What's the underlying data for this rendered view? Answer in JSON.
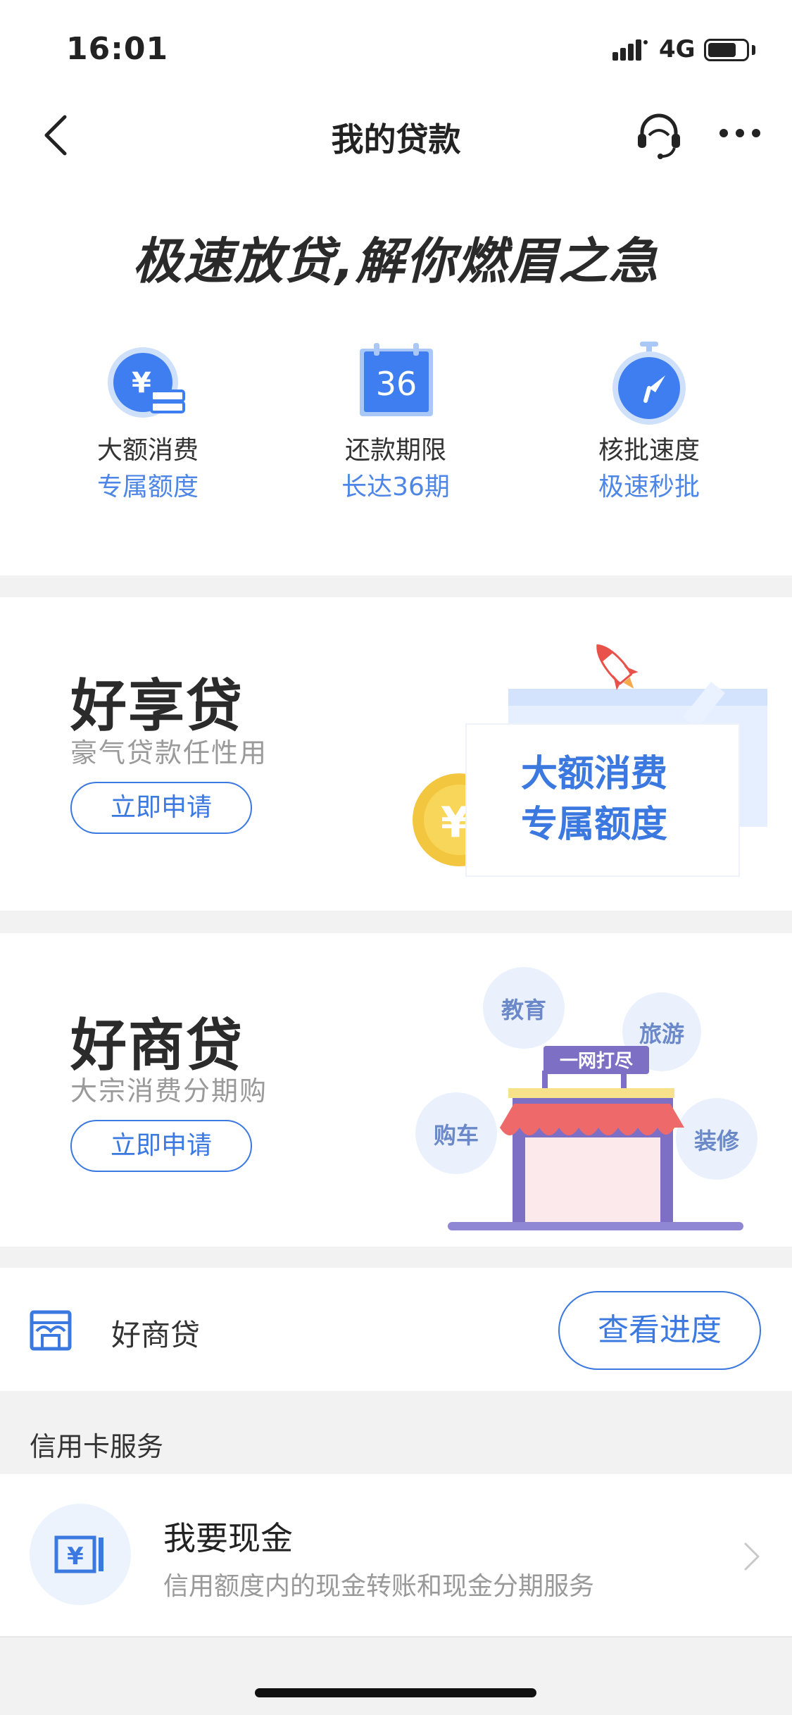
{
  "status_bar": {
    "time": "16:01",
    "network": "4G",
    "battery_level": 0.75
  },
  "nav": {
    "title": "我的贷款",
    "back_icon": "chevron-left-icon",
    "support_icon": "headset-icon",
    "more_icon": "more-dots-icon"
  },
  "hero": {
    "slogan": "极速放贷,解你燃眉之急",
    "features": [
      {
        "title": "大额消费",
        "subtitle": "专属额度",
        "icon": "yuan-coin-icon"
      },
      {
        "title": "还款期限",
        "subtitle": "长达36期",
        "icon": "calendar-icon",
        "icon_text": "36"
      },
      {
        "title": "核批速度",
        "subtitle": "极速秒批",
        "icon": "stopwatch-icon"
      }
    ]
  },
  "cards": [
    {
      "name": "好享贷",
      "tagline": "豪气贷款任性用",
      "button": "立即申请",
      "illustration_text": [
        "大额消费",
        "专属额度"
      ]
    },
    {
      "name": "好商贷",
      "tagline": "大宗消费分期购",
      "button": "立即申请",
      "illustration_sign": "一网打尽",
      "illustration_bubbles": [
        "教育",
        "旅游",
        "购车",
        "装修"
      ]
    }
  ],
  "progress_row": {
    "label": "好商贷",
    "button": "查看进度",
    "icon": "shop-icon"
  },
  "credit_service": {
    "section_title": "信用卡服务",
    "items": [
      {
        "title": "我要现金",
        "description": "信用额度内的现金转账和现金分期服务",
        "icon": "cash-yuan-icon"
      }
    ]
  },
  "colors": {
    "accent": "#3b78e0",
    "subtitle_blue": "#4d86e6",
    "page_bg": "#f2f2f2"
  }
}
